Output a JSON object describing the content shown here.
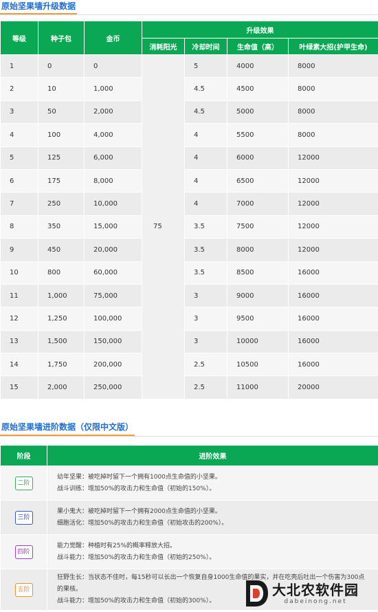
{
  "section1": {
    "title": "原始坚果墙升级数据"
  },
  "section2": {
    "title": "原始坚果墙进阶数据（仅限中文版）"
  },
  "upgrade_table": {
    "headers": {
      "level": "等级",
      "seed_pack": "种子包",
      "coins": "金币",
      "upgrade_effect": "升级效果",
      "sun_cost": "消耗阳光",
      "cooldown": "冷却时间",
      "health": "生命值（高）",
      "chlorophyll": "叶绿素大招(护甲生命)"
    },
    "sun_cost_value": "75",
    "rows": [
      {
        "level": "1",
        "seed": "0",
        "coins": "0",
        "cooldown": "5",
        "health": "4000",
        "armor": "8000"
      },
      {
        "level": "2",
        "seed": "10",
        "coins": "1,000",
        "cooldown": "4.5",
        "health": "4500",
        "armor": "8000"
      },
      {
        "level": "3",
        "seed": "50",
        "coins": "2,000",
        "cooldown": "4.5",
        "health": "5000",
        "armor": "8000"
      },
      {
        "level": "4",
        "seed": "100",
        "coins": "4,000",
        "cooldown": "4",
        "health": "5500",
        "armor": "8000"
      },
      {
        "level": "5",
        "seed": "125",
        "coins": "6,000",
        "cooldown": "4",
        "health": "6000",
        "armor": "12000"
      },
      {
        "level": "6",
        "seed": "175",
        "coins": "8,000",
        "cooldown": "4",
        "health": "6500",
        "armor": "12000"
      },
      {
        "level": "7",
        "seed": "250",
        "coins": "10,000",
        "cooldown": "4",
        "health": "7000",
        "armor": "12000"
      },
      {
        "level": "8",
        "seed": "350",
        "coins": "15,000",
        "cooldown": "3.5",
        "health": "7500",
        "armor": "12000"
      },
      {
        "level": "9",
        "seed": "450",
        "coins": "20,000",
        "cooldown": "3.5",
        "health": "8000",
        "armor": "12000"
      },
      {
        "level": "10",
        "seed": "800",
        "coins": "60,000",
        "cooldown": "3.5",
        "health": "8500",
        "armor": "16000"
      },
      {
        "level": "11",
        "seed": "1,000",
        "coins": "75,000",
        "cooldown": "3",
        "health": "9000",
        "armor": "16000"
      },
      {
        "level": "12",
        "seed": "1,250",
        "coins": "100,000",
        "cooldown": "3",
        "health": "9500",
        "armor": "16000"
      },
      {
        "level": "13",
        "seed": "1,500",
        "coins": "150,000",
        "cooldown": "3",
        "health": "10000",
        "armor": "16000"
      },
      {
        "level": "14",
        "seed": "1,750",
        "coins": "200,000",
        "cooldown": "2.5",
        "health": "10500",
        "armor": "16000"
      },
      {
        "level": "15",
        "seed": "2,000",
        "coins": "250,000",
        "cooldown": "2.5",
        "health": "11000",
        "armor": "20000"
      }
    ]
  },
  "advance_table": {
    "headers": {
      "stage": "阶段",
      "effect": "进阶效果"
    },
    "rows": [
      {
        "stage": "二阶",
        "color": "#3aa95c",
        "lines": [
          "幼年坚果：被吃掉时留下一个拥有1000点生命值的小坚果。",
          "战斗训练：增加50%的攻击力和生命值（初始的150%）。"
        ]
      },
      {
        "stage": "三阶",
        "color": "#3d55b8",
        "lines": [
          "果小鬼大：被吃掉时留下一个拥有2000点生命值的小坚果。",
          "细胞活化：增加50%的攻击力和生命值（初始攻击的200%）。"
        ]
      },
      {
        "stage": "四阶",
        "color": "#9b3fc4",
        "lines": [
          "能力觉醒：种植时有25%的概率释放大招。",
          "战斗能力：增加50%的攻击力和生命值（初始的250%）。"
        ]
      },
      {
        "stage": "五阶",
        "color": "#e8922c",
        "lines": [
          "狂野生长：当状态不佳时，每15秒可以长出一个恢复自身1000生命值的果实，并在吃壳后吐出一个伤害为300点的果核。",
          "战斗能力：增加50%的攻击力和生命值（初始的300%）。"
        ]
      }
    ]
  },
  "watermark": {
    "name": "大北农软件园",
    "url": "dabeinong.net"
  }
}
